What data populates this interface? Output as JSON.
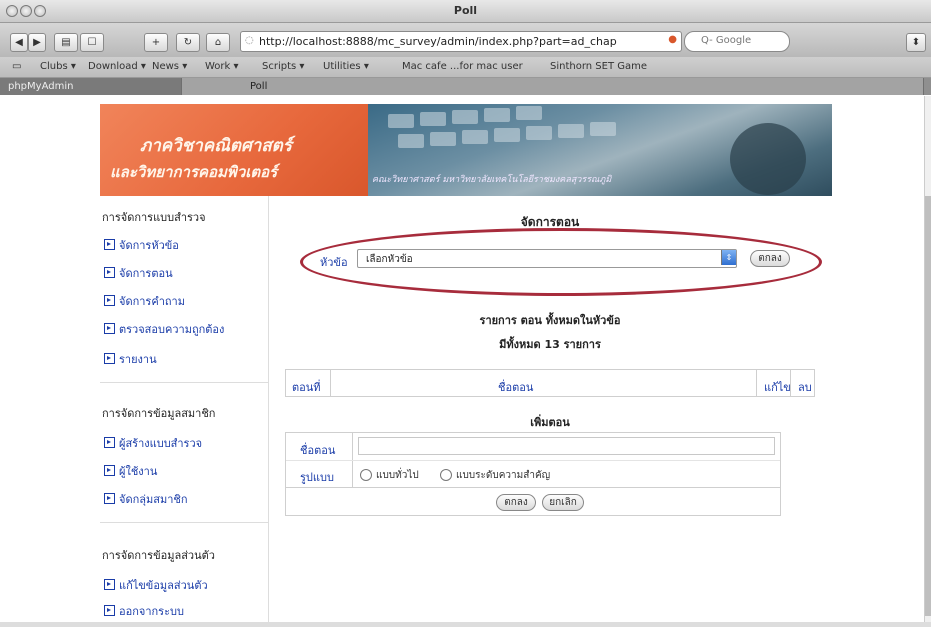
{
  "window": {
    "title": "Poll"
  },
  "toolbar": {
    "url": "http://localhost:8888/mc_survey/admin/index.php?part=ad_chap",
    "search_placeholder": "Q- Google",
    "back_label": "◀",
    "forward_label": "▶"
  },
  "bookmarks": [
    "Clubs ▾",
    "Download ▾",
    "News ▾",
    "Work ▾",
    "Scripts ▾",
    "Utilities ▾",
    "Mac cafe ...for mac user",
    "Sinthorn SET Game"
  ],
  "tabs": [
    "phpMyAdmin",
    "Poll"
  ],
  "banner": {
    "line1": "ภาควิชาคณิตศาสตร์",
    "line2": "และวิทยาการคอมพิวเตอร์",
    "subtitle": "คณะวิทยาศาสตร์ มหาวิทยาลัยเทคโนโลยีราชมงคลสุวรรณภูมิ"
  },
  "sidebar": {
    "sections": [
      {
        "heading": "การจัดการแบบสำรวจ",
        "items": [
          "จัดการหัวข้อ",
          "จัดการตอน",
          "จัดการคำถาม",
          "ตรวจสอบความถูกต้อง",
          "รายงาน"
        ]
      },
      {
        "heading": "การจัดการข้อมูลสมาชิก",
        "items": [
          "ผู้สร้างแบบสำรวจ",
          "ผู้ใช้งาน",
          "จัดกลุ่มสมาชิก"
        ]
      },
      {
        "heading": "การจัดการข้อมูลส่วนตัว",
        "items": [
          "แก้ไขข้อมูลส่วนตัว",
          "ออกจากระบบ"
        ]
      }
    ]
  },
  "main": {
    "title": "จัดการตอน",
    "topic_label": "หัวข้อ",
    "topic_selected": "เลือกหัวข้อ",
    "ok_label": "ตกลง",
    "list_title": "รายการ ตอน ทั้งหมดในหัวข้อ",
    "list_count": "มีทั้งหมด 13 รายการ",
    "columns": [
      "ตอนที่",
      "ชื่อตอน",
      "แก้ไข",
      "ลบ"
    ],
    "add_title": "เพิ่มตอน",
    "name_label": "ชื่อตอน",
    "type_label": "รูปแบบ",
    "options": [
      "แบบทั่วไป",
      "แบบระดับความสำคัญ"
    ],
    "submit_label": "ตกลง",
    "cancel_label": "ยกเลิก"
  },
  "colors": {
    "accent": "#a72c3c",
    "link": "#1a3ca8",
    "banner": "#e7683c"
  }
}
